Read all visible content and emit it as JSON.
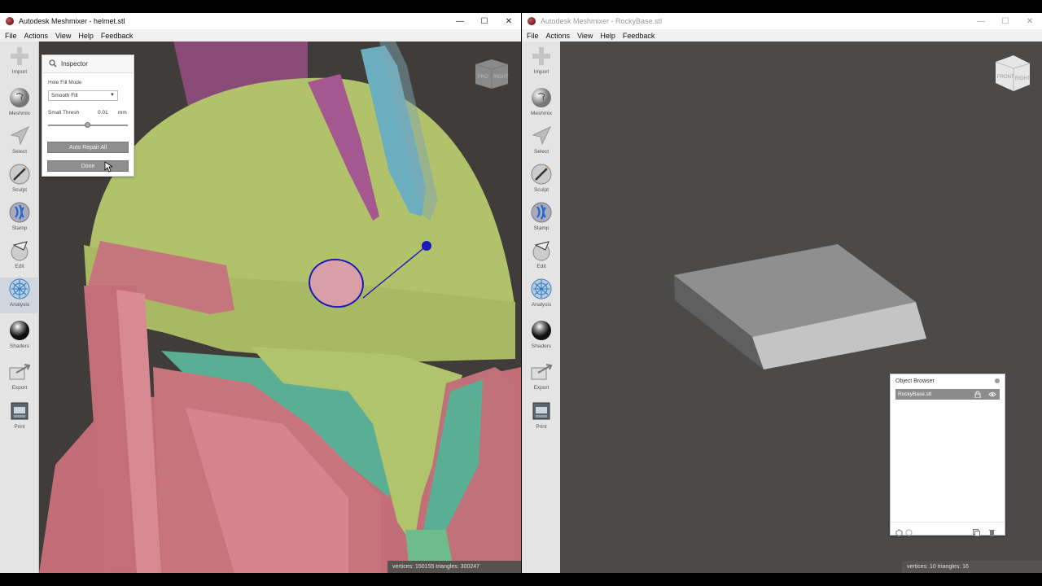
{
  "left_window": {
    "title": "Autodesk Meshmixer - helmet.stl",
    "menu": [
      "File",
      "Actions",
      "View",
      "Help",
      "Feedback"
    ],
    "status": "vertices: 150155  triangles: 300247",
    "viewcube_labels": [
      "RIGHT",
      "FRO"
    ]
  },
  "right_window": {
    "title": "Autodesk Meshmixer - RockyBase.stl",
    "menu": [
      "File",
      "Actions",
      "View",
      "Help",
      "Feedback"
    ],
    "status": "vertices: 10  triangles: 16",
    "viewcube_labels": [
      "RIGHT",
      "FRONT"
    ]
  },
  "window_controls": {
    "minimize": "—",
    "maximize": "☐",
    "close": "✕"
  },
  "tools": [
    {
      "label": "Import",
      "icon": "plus-icon"
    },
    {
      "label": "Meshmix",
      "icon": "meshmix-sphere-icon"
    },
    {
      "label": "Select",
      "icon": "select-arrow-icon"
    },
    {
      "label": "Sculpt",
      "icon": "sculpt-brush-icon"
    },
    {
      "label": "Stamp",
      "icon": "stamp-icon"
    },
    {
      "label": "Edit",
      "icon": "edit-icon"
    },
    {
      "label": "Analysis",
      "icon": "analysis-icon"
    },
    {
      "label": "Shaders",
      "icon": "shaders-sphere-icon"
    },
    {
      "label": "Export",
      "icon": "export-icon"
    },
    {
      "label": "Print",
      "icon": "print-icon"
    }
  ],
  "active_tool": "Analysis",
  "inspector": {
    "title": "Inspector",
    "hole_fill_mode_label": "Hole Fill Mode",
    "hole_fill_mode_value": "Smooth Fill",
    "small_thresh_label": "Small Thresh",
    "small_thresh_value": "0.01",
    "small_thresh_unit": "mm",
    "small_thresh_slider_fraction": 0.5,
    "auto_repair_label": "Auto Repair All",
    "done_label": "Done"
  },
  "object_browser": {
    "title": "Object Browser",
    "items": [
      {
        "name": "RockyBase.stl"
      }
    ]
  },
  "colors": {
    "helmet_green": "#b5c46e",
    "helmet_pink": "#c7747e",
    "helmet_teal": "#5fb39a",
    "helmet_blue_stripe": "#6aaebf",
    "helmet_magenta": "#b05ea0",
    "selection_blue": "#1a1ab8",
    "base_gray": "#8f8f8f"
  }
}
